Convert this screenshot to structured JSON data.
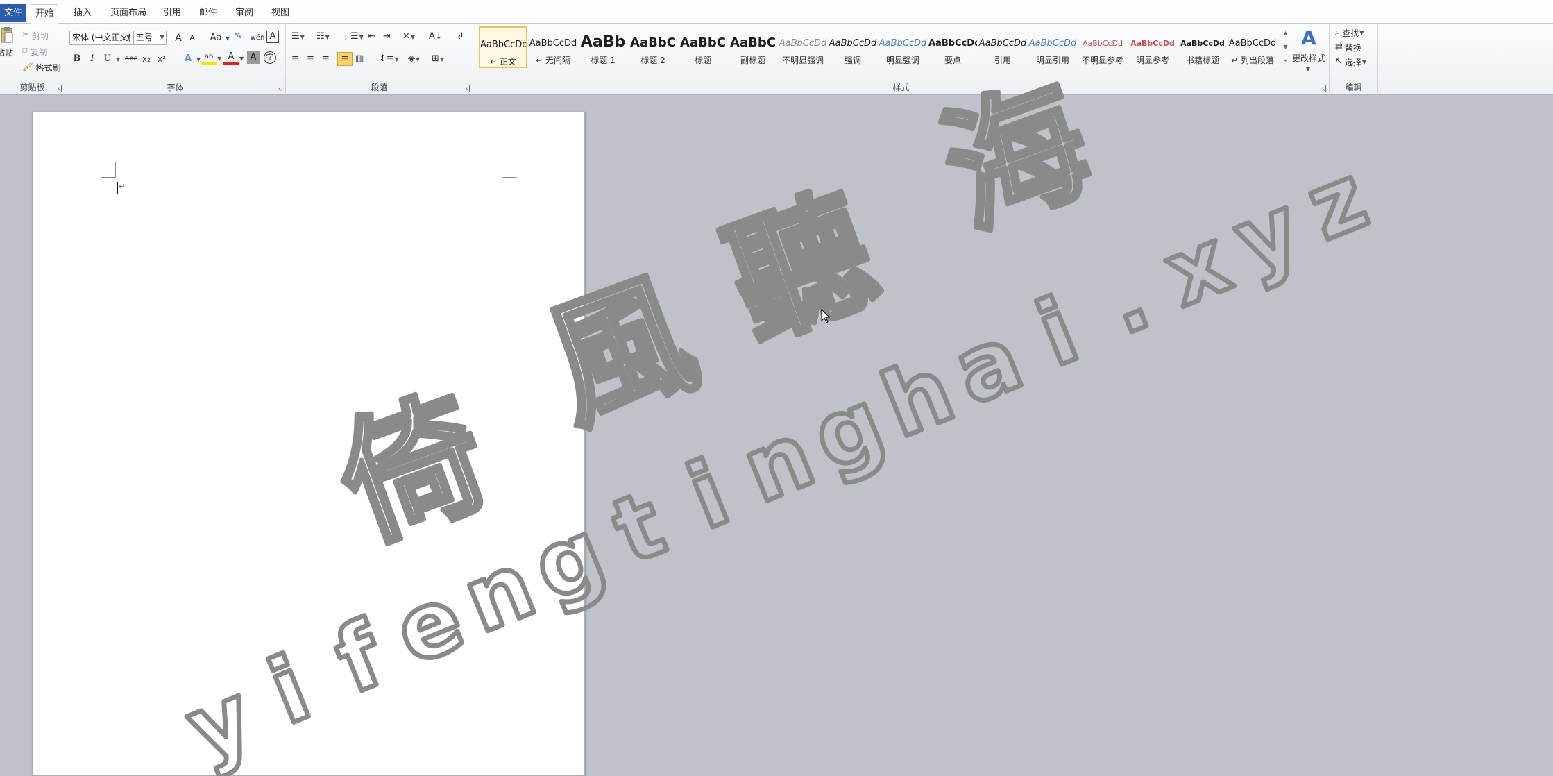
{
  "tabs": {
    "file": "文件",
    "home": "开始",
    "insert": "插入",
    "page_layout": "页面布局",
    "references": "引用",
    "mailings": "邮件",
    "review": "审阅",
    "view": "视图"
  },
  "clipboard": {
    "paste": "粘贴",
    "cut": "剪切",
    "copy": "复制",
    "format_painter": "格式刷",
    "label": "剪贴板"
  },
  "font": {
    "name": "宋体 (中文正文)",
    "size": "五号",
    "grow": "A",
    "shrink": "A",
    "change_case": "Aa",
    "phonetic": "wén",
    "char_border": "A",
    "bold": "B",
    "italic": "I",
    "underline": "U",
    "strike": "abc",
    "subscript": "x₂",
    "superscript": "x²",
    "effects": "A",
    "highlight": "ab",
    "color": "A",
    "shading": "A",
    "enclose": "字",
    "label": "字体"
  },
  "paragraph": {
    "label": "段落"
  },
  "styles": {
    "label": "样式",
    "items": [
      {
        "preview": "AaBbCcDd",
        "name": "↵ 正文"
      },
      {
        "preview": "AaBbCcDd",
        "name": "↵ 无间隔"
      },
      {
        "preview": "AaBb",
        "name": "标题 1"
      },
      {
        "preview": "AaBbC",
        "name": "标题 2"
      },
      {
        "preview": "AaBbC",
        "name": "标题"
      },
      {
        "preview": "AaBbC",
        "name": "副标题"
      },
      {
        "preview": "AaBbCcDd",
        "name": "不明显强调"
      },
      {
        "preview": "AaBbCcDd",
        "name": "强调"
      },
      {
        "preview": "AaBbCcDd",
        "name": "明显强调"
      },
      {
        "preview": "AaBbCcDd",
        "name": "要点"
      },
      {
        "preview": "AaBbCcDd",
        "name": "引用"
      },
      {
        "preview": "AaBbCcDd",
        "name": "明显引用"
      },
      {
        "preview": "AaBbCcDd",
        "name": "不明显参考"
      },
      {
        "preview": "AaBbCcDd",
        "name": "明显参考"
      },
      {
        "preview": "AaBbCcDd",
        "name": "书籍标题"
      },
      {
        "preview": "AaBbCcDd",
        "name": "↵ 列出段落"
      }
    ],
    "change_styles": "更改样式"
  },
  "editing": {
    "find": "查找",
    "replace": "替换",
    "select": "选择",
    "label": "编辑"
  },
  "document": {
    "paragraph_mark": "↵"
  },
  "watermark": {
    "chinese": [
      "倚",
      "風",
      "聽",
      "海"
    ],
    "url": [
      "y",
      "i",
      "f",
      "e",
      "n",
      "g",
      "t",
      "i",
      "n",
      "g",
      "h",
      "a",
      "i",
      ".",
      "x",
      "y",
      "z"
    ],
    "color": "#8a8a8a"
  },
  "colors": {
    "file_tab": "#2a5cab",
    "workspace": "#bfc3c9",
    "selected_style": "#f2c155",
    "font_color_red": "#e02020",
    "highlight_yellow": "#f5e400"
  }
}
